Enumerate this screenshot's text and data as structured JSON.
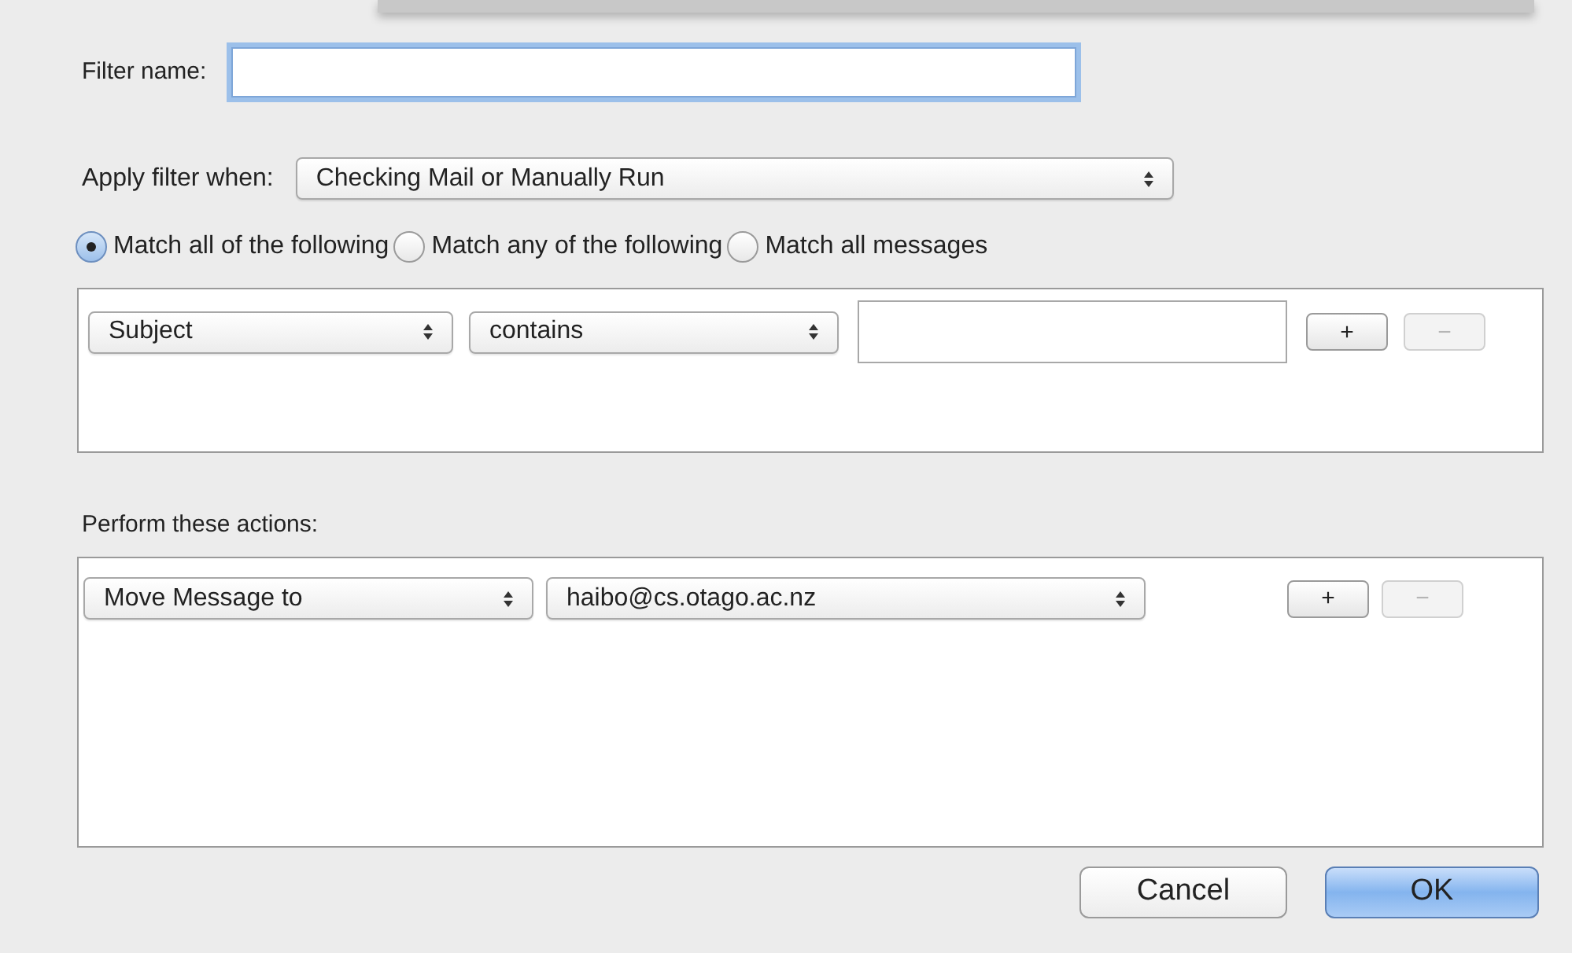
{
  "filter_name": {
    "label": "Filter name:",
    "focused": true
  },
  "apply_when": {
    "label": "Apply filter when:",
    "value": "Checking Mail or Manually Run"
  },
  "match_options": [
    {
      "label": "Match all of the following",
      "selected": true
    },
    {
      "label": "Match any of the following",
      "selected": false
    },
    {
      "label": "Match all messages",
      "selected": false
    }
  ],
  "conditions": [
    {
      "field": "Subject",
      "operator": "contains",
      "add_button": {
        "label": "+",
        "disabled": false
      },
      "remove_button": {
        "label": "−",
        "disabled": true
      }
    }
  ],
  "actions_label": "Perform these actions:",
  "actions": [
    {
      "action": "Move Message to",
      "target": "haibo@cs.otago.ac.nz",
      "add_button": {
        "label": "+",
        "disabled": false
      },
      "remove_button": {
        "label": "−",
        "disabled": true
      }
    }
  ],
  "buttons": [
    {
      "label": "Cancel",
      "default": false
    },
    {
      "label": "OK",
      "default": true
    }
  ]
}
